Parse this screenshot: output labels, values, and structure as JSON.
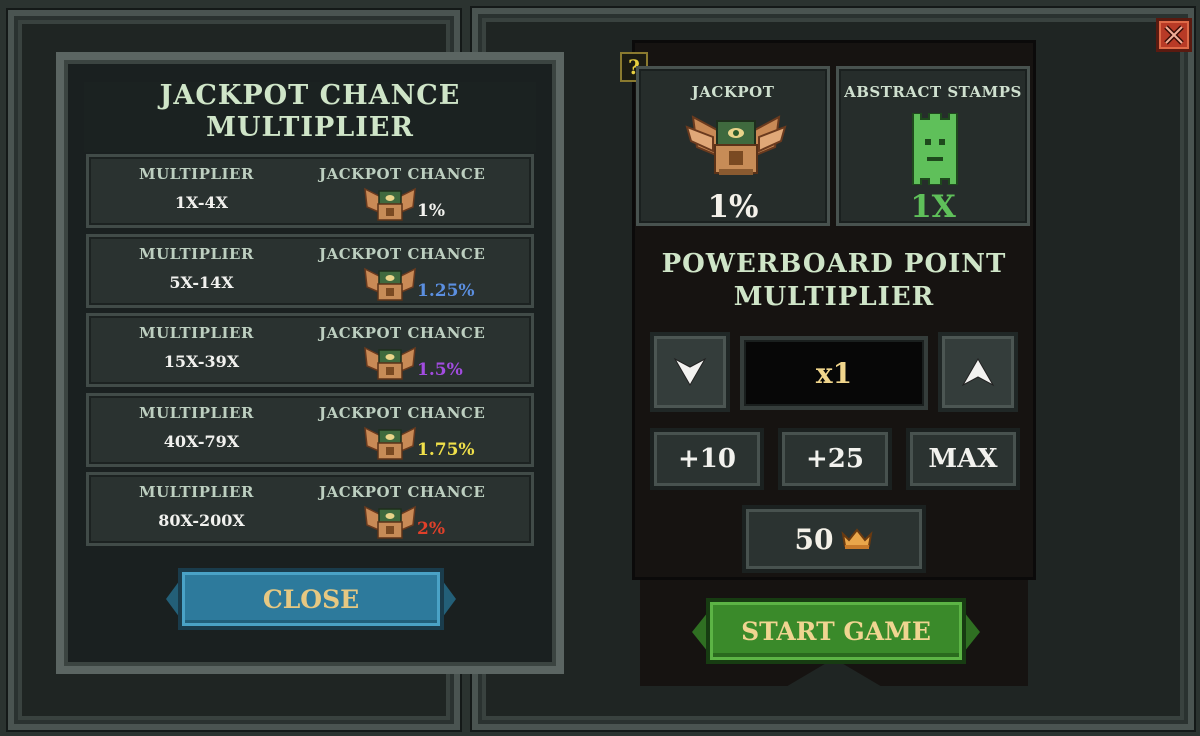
{
  "left_panel": {
    "title_line1": "JACKPOT CHANCE",
    "title_line2": "MULTIPLIER",
    "rows": [
      {
        "label_a": "MULTIPLIER",
        "label_b": "JACKPOT CHANCE",
        "range": "1X-4X",
        "chance": "1%",
        "color": "#f2f2ee"
      },
      {
        "label_a": "MULTIPLIER",
        "label_b": "JACKPOT CHANCE",
        "range": "5X-14X",
        "chance": "1.25%",
        "color": "#5b8fe0"
      },
      {
        "label_a": "MULTIPLIER",
        "label_b": "JACKPOT CHANCE",
        "range": "15X-39X",
        "chance": "1.5%",
        "color": "#a24ce0"
      },
      {
        "label_a": "MULTIPLIER",
        "label_b": "JACKPOT CHANCE",
        "range": "40X-79X",
        "chance": "1.75%",
        "color": "#f0e04a"
      },
      {
        "label_a": "MULTIPLIER",
        "label_b": "JACKPOT CHANCE",
        "range": "80X-200X",
        "chance": "2%",
        "color": "#e0402a"
      }
    ],
    "close_label": "CLOSE"
  },
  "right_panel": {
    "help_label": "?",
    "jackpot": {
      "title": "JACKPOT",
      "value": "1%",
      "icon": "jackpot-chest-icon"
    },
    "stamps": {
      "title": "ABSTRACT STAMPS",
      "value": "1X",
      "icon": "stamp-icon"
    },
    "pb_title_line1": "POWERBOARD POINT",
    "pb_title_line2": "MULTIPLIER",
    "multiplier_value": "x1",
    "inc_10": "+10",
    "inc_25": "+25",
    "inc_max": "MAX",
    "cost": "50",
    "cost_icon": "crown-icon",
    "start_label": "START GAME",
    "close_icon": "close-x-icon"
  },
  "colors": {
    "stamp_green": "#5fc05a",
    "close_blue": "#2d7a9c",
    "start_green": "#3a8a2a"
  }
}
